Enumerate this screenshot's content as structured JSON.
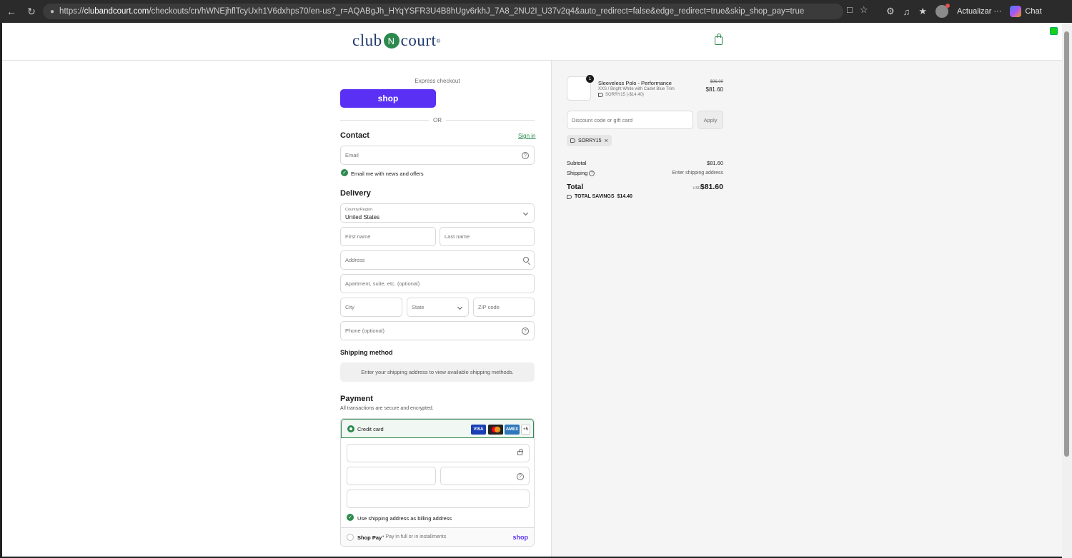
{
  "browser": {
    "url_prefix": "https://",
    "url_host": "clubandcourt.com",
    "url_path": "/checkouts/cn/hWNEjhflTcyUxh1V6dxhps70/en-us?_r=AQABgJh_HYqYSFR3U4B8hUgv6rkhJ_7A8_2NU2I_U37v2q4&auto_redirect=false&edge_redirect=true&skip_shop_pay=true",
    "update_label": "Actualizar",
    "more_label": "···",
    "chat_label": "Chat"
  },
  "header": {
    "logo_left": "club",
    "logo_mark": "N",
    "logo_right": "court",
    "logo_reg": "®"
  },
  "express": {
    "label": "Express checkout",
    "shop_button": "shop",
    "or_label": "OR"
  },
  "contact": {
    "title": "Contact",
    "signin": "Sign in",
    "email_placeholder": "Email",
    "news_label": "Email me with news and offers"
  },
  "delivery": {
    "title": "Delivery",
    "country_label": "Country/Region",
    "country_value": "United States",
    "first_name": "First name",
    "last_name": "Last name",
    "address": "Address",
    "apartment": "Apartment, suite, etc. (optional)",
    "city": "City",
    "state": "State",
    "zip": "ZIP code",
    "phone": "Phone (optional)"
  },
  "shipping_method": {
    "title": "Shipping method",
    "message": "Enter your shipping address to view available shipping methods."
  },
  "payment": {
    "title": "Payment",
    "subtitle": "All transactions are secure and encrypted.",
    "credit_card": "Credit card",
    "cards": [
      "VISA",
      "MC",
      "AMEX",
      "+5"
    ],
    "billing_label": "Use shipping address as billing address",
    "shop_pay": "Shop Pay",
    "shop_pay_sub": "• Pay in full or in installments",
    "shop_pay_logo": "shop"
  },
  "order": {
    "quantity": "1",
    "product_name": "Sleeveless Polo - Performance",
    "variant": "XXS / Bright White with Cadet Blue Trim",
    "discount_line": "SORRY15 (-$14.40)",
    "old_price": "$96.00",
    "price": "$81.60",
    "discount_placeholder": "Discount code or gift card",
    "apply": "Apply",
    "applied_code": "SORRY15",
    "subtotal_label": "Subtotal",
    "subtotal_value": "$81.60",
    "shipping_label": "Shipping",
    "shipping_value": "Enter shipping address",
    "total_label": "Total",
    "currency": "USD",
    "total_value": "$81.60",
    "savings_label": "TOTAL SAVINGS",
    "savings_value": "$14.40"
  },
  "colors": {
    "brand_green": "#2d8a4e",
    "shop_purple": "#5a31f4",
    "logo_navy": "#1f3a6e"
  }
}
